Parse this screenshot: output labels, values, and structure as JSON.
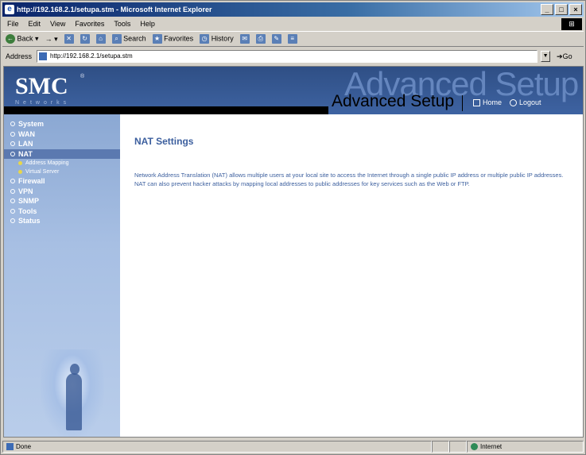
{
  "window": {
    "title": "http://192.168.2.1/setupa.stm - Microsoft Internet Explorer",
    "controls": [
      "_",
      "□",
      "×"
    ]
  },
  "menu": [
    "File",
    "Edit",
    "View",
    "Favorites",
    "Tools",
    "Help"
  ],
  "toolbar": {
    "back": "Back",
    "search": "Search",
    "favorites": "Favorites",
    "history": "History"
  },
  "address": {
    "label": "Address",
    "url": "http://192.168.2.1/setupa.stm",
    "go": "Go"
  },
  "header": {
    "logo": "SMC",
    "logo_mark": "®",
    "logo_sub": "Networks",
    "watermark": "Advanced Setup",
    "title": "Advanced Setup",
    "home": "Home",
    "logout": "Logout"
  },
  "sidebar": {
    "items": [
      {
        "label": "System"
      },
      {
        "label": "WAN"
      },
      {
        "label": "LAN"
      },
      {
        "label": "NAT"
      },
      {
        "label": "Firewall"
      },
      {
        "label": "VPN"
      },
      {
        "label": "SNMP"
      },
      {
        "label": "Tools"
      },
      {
        "label": "Status"
      }
    ],
    "nat_sub": [
      "Address Mapping",
      "Virtual Server"
    ]
  },
  "main": {
    "title": "NAT Settings",
    "description": "Network Address Translation (NAT) allows multiple users at your local site to access the Internet through a single public IP address or multiple public IP addresses. NAT can also prevent hacker attacks by mapping local addresses to public addresses for key services such as the Web or FTP."
  },
  "status": {
    "left": "Done",
    "zone": "Internet"
  },
  "colors": {
    "header_bg": "#3e63a2",
    "sidebar_bg": "#a7bfe3",
    "accent_text": "#3c5f9e"
  }
}
